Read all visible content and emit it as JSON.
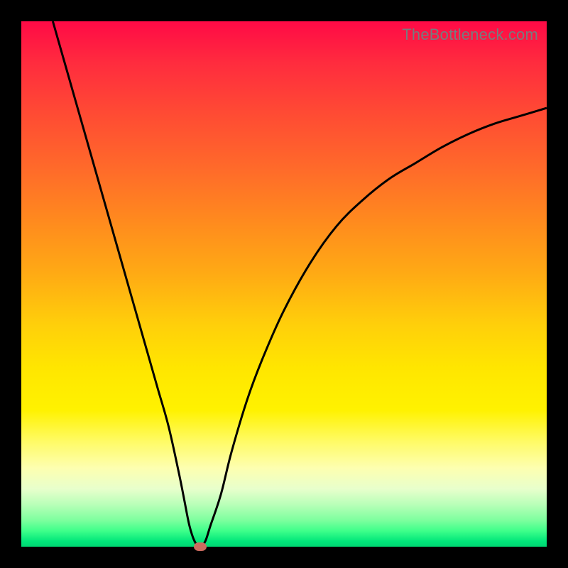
{
  "watermark": "TheBottleneck.com",
  "colors": {
    "background": "#000000",
    "curve_stroke": "#000000",
    "marker_fill": "#cc6a5f",
    "watermark_text": "#777b7e"
  },
  "chart_data": {
    "type": "line",
    "title": "",
    "xlabel": "",
    "ylabel": "",
    "xlim": [
      0,
      100
    ],
    "ylim": [
      0,
      100
    ],
    "grid": false,
    "legend": false,
    "series": [
      {
        "name": "bottleneck-curve",
        "x": [
          6,
          8,
          10,
          12,
          14,
          16,
          18,
          20,
          22,
          24,
          26,
          28,
          30,
          31,
          32,
          33,
          34,
          35,
          36,
          38,
          40,
          43,
          46,
          50,
          55,
          60,
          65,
          70,
          75,
          80,
          85,
          90,
          95,
          100
        ],
        "y": [
          100,
          93,
          86,
          79,
          72,
          65,
          58,
          51,
          44,
          37,
          30,
          23,
          14,
          9,
          4,
          1,
          0,
          1,
          4,
          10,
          18,
          28,
          36,
          45,
          54,
          61,
          66,
          70,
          73,
          76,
          78.5,
          80.5,
          82,
          83.5
        ]
      }
    ],
    "marker": {
      "x": 34,
      "y": 0
    },
    "gradient_stops": [
      {
        "pos": 0.0,
        "color": "#ff0a46"
      },
      {
        "pos": 0.5,
        "color": "#ffd00a"
      },
      {
        "pos": 0.8,
        "color": "#fffb66"
      },
      {
        "pos": 0.95,
        "color": "#7cff9e"
      },
      {
        "pos": 1.0,
        "color": "#00d672"
      }
    ]
  }
}
